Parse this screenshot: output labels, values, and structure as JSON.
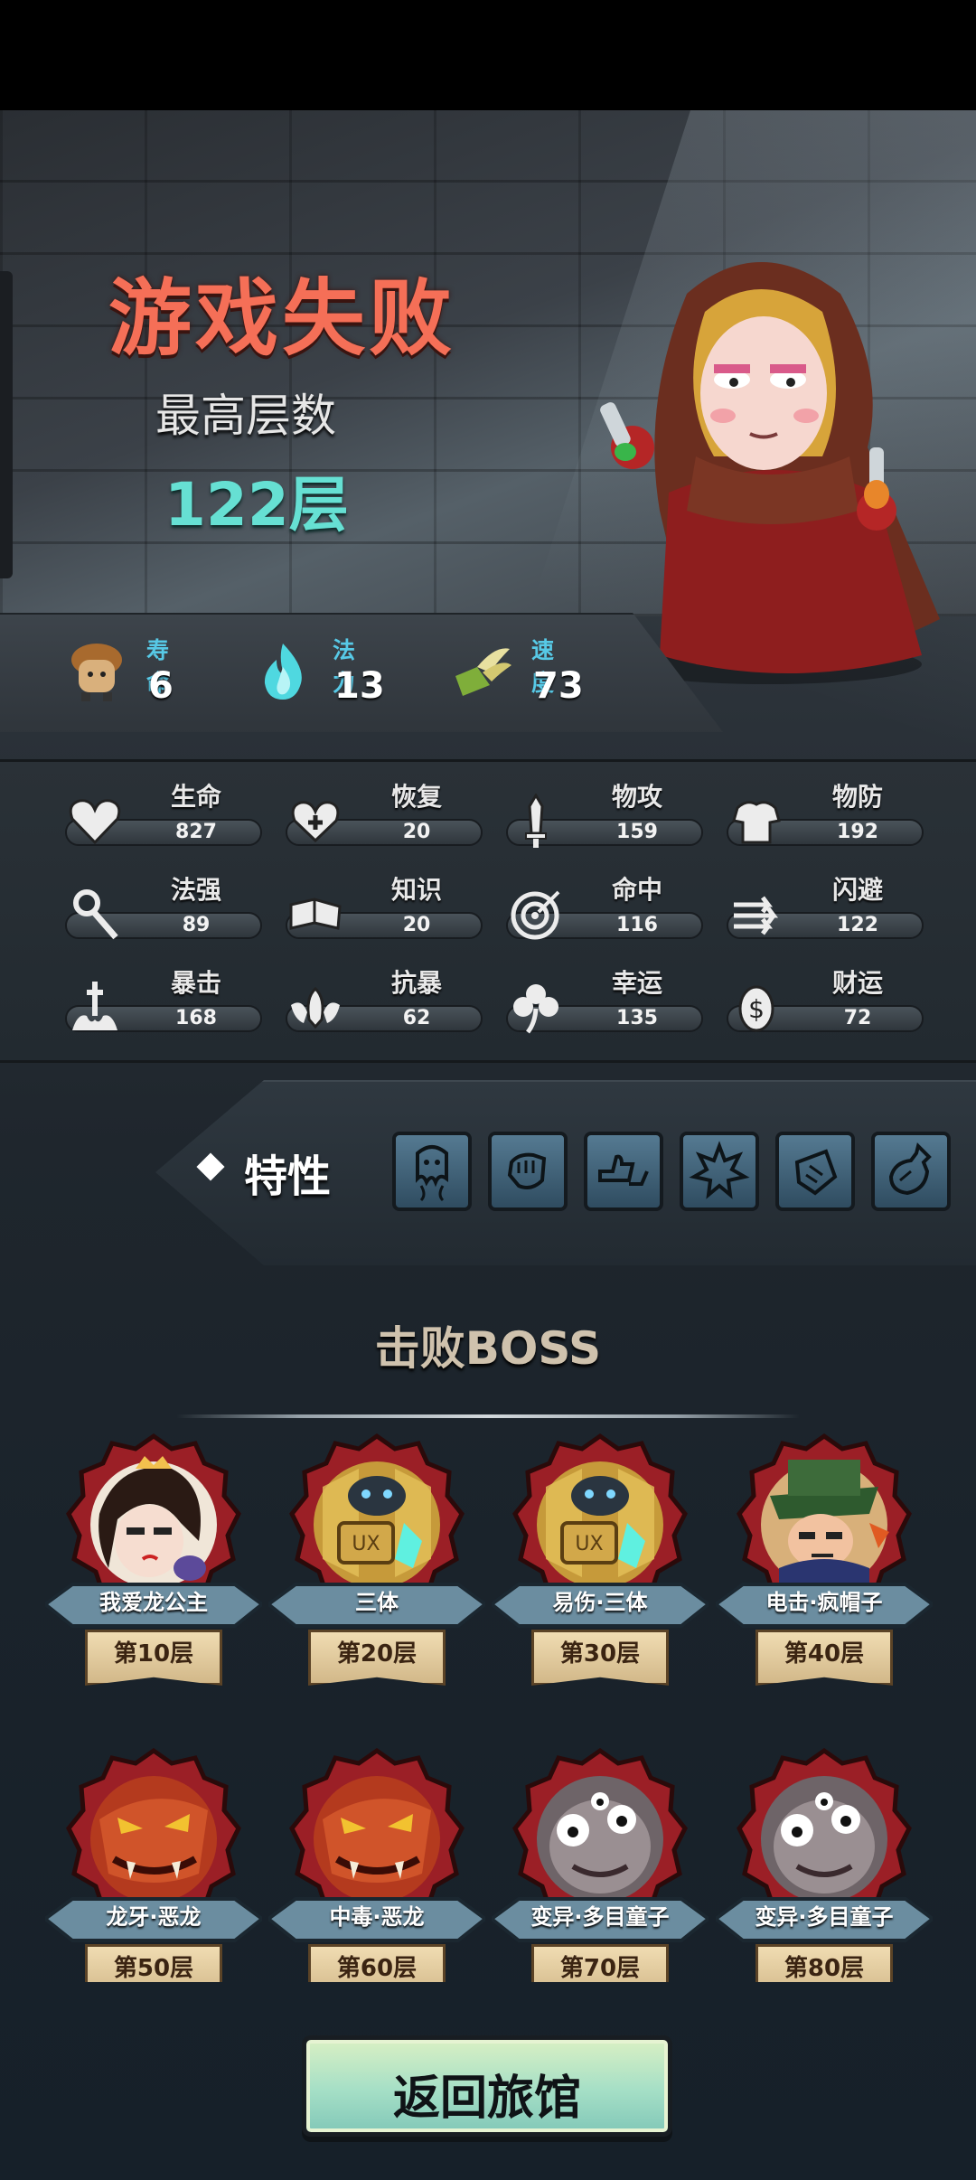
{
  "result": {
    "title": "游戏失败",
    "max_floor_label": "最高层数",
    "max_floor_value": "122层"
  },
  "top_stats": [
    {
      "label": "寿命",
      "value": "6",
      "icon": "mushroom-hero-icon"
    },
    {
      "label": "法力",
      "value": "13",
      "icon": "blue-flame-icon"
    },
    {
      "label": "速度",
      "value": "73",
      "icon": "winged-boot-icon"
    }
  ],
  "stats": [
    {
      "label": "生命",
      "value": "827",
      "icon": "heart-icon"
    },
    {
      "label": "恢复",
      "value": "20",
      "icon": "heal-heart-icon"
    },
    {
      "label": "物攻",
      "value": "159",
      "icon": "sword-icon"
    },
    {
      "label": "物防",
      "value": "192",
      "icon": "armor-icon"
    },
    {
      "label": "法强",
      "value": "89",
      "icon": "magic-staff-icon"
    },
    {
      "label": "知识",
      "value": "20",
      "icon": "book-icon"
    },
    {
      "label": "命中",
      "value": "116",
      "icon": "target-icon"
    },
    {
      "label": "闪避",
      "value": "122",
      "icon": "dodge-arrows-icon"
    },
    {
      "label": "暴击",
      "value": "168",
      "icon": "critical-sword-icon"
    },
    {
      "label": "抗暴",
      "value": "62",
      "icon": "shield-wings-icon"
    },
    {
      "label": "幸运",
      "value": "135",
      "icon": "clover-icon"
    },
    {
      "label": "财运",
      "value": "72",
      "icon": "coin-icon"
    }
  ],
  "traits": {
    "label": "特性",
    "items": [
      "ghost-trait-icon",
      "fist-trait-icon",
      "thumbs-trait-icon",
      "splash-trait-icon",
      "potion-bag-trait-icon",
      "bottle-trait-icon"
    ]
  },
  "bosses": {
    "title": "击败BOSS",
    "items": [
      {
        "name": "我爱龙公主",
        "floor": "第10层",
        "portrait": "princess-portrait"
      },
      {
        "name": "三体",
        "floor": "第20层",
        "portrait": "robot-portrait"
      },
      {
        "name": "易伤·三体",
        "floor": "第30层",
        "portrait": "robot-portrait"
      },
      {
        "name": "电击·疯帽子",
        "floor": "第40层",
        "portrait": "mad-hatter-portrait"
      },
      {
        "name": "龙牙·恶龙",
        "floor": "第50层",
        "portrait": "dragon-portrait"
      },
      {
        "name": "中毒·恶龙",
        "floor": "第60层",
        "portrait": "dragon-portrait"
      },
      {
        "name": "变异·多目童子",
        "floor": "第70层",
        "portrait": "many-eyes-portrait"
      },
      {
        "name": "变异·多目童子",
        "floor": "第80层",
        "portrait": "many-eyes-portrait"
      }
    ]
  },
  "return_button": "返回旅馆"
}
